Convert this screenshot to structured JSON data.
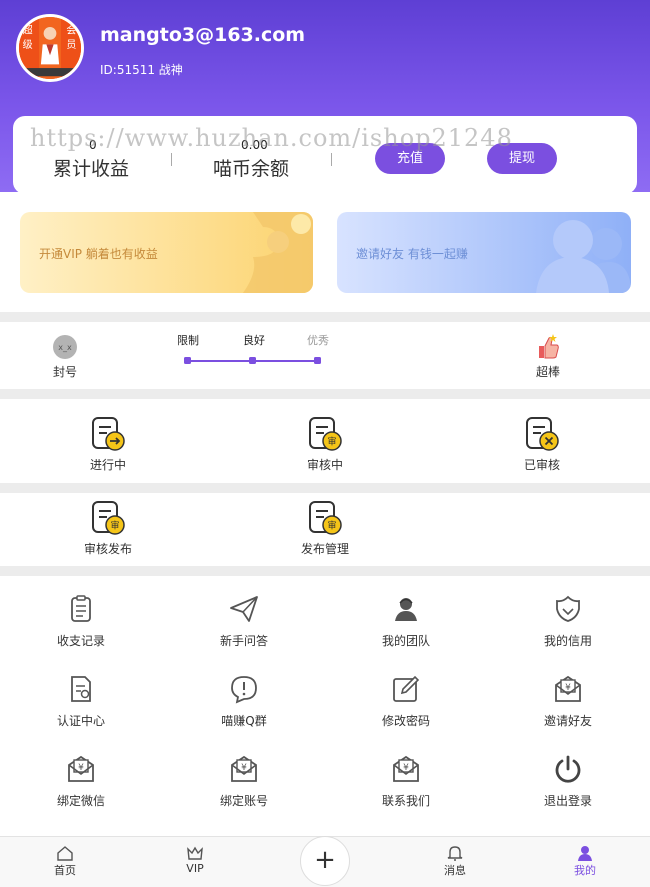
{
  "profile": {
    "email": "mangto3@163.com",
    "uid_text": "ID:51511 战神",
    "avatar_badge": [
      "超",
      "级",
      "会",
      "员"
    ]
  },
  "balance": {
    "total_earnings_value": "0",
    "total_earnings_label": "累计收益",
    "coin_balance_value": "0.00",
    "coin_balance_label": "喵币余额",
    "recharge_label": "充值",
    "withdraw_label": "提现"
  },
  "watermark": "https://www.huzhan.com/ishop21248",
  "banners": {
    "vip_text": "开通VIP 躺着也有收益",
    "invite_text": "邀请好友 有钱一起赚"
  },
  "credit": {
    "banned_label": "封号",
    "excellent_label": "超棒",
    "levels": [
      "限制",
      "良好",
      "优秀"
    ]
  },
  "orders": {
    "row1": [
      {
        "label": "进行中",
        "icon": "task-in-progress-icon"
      },
      {
        "label": "审核中",
        "icon": "task-reviewing-icon"
      },
      {
        "label": "已审核",
        "icon": "task-reviewed-icon"
      }
    ],
    "row2": [
      {
        "label": "审核发布",
        "icon": "review-publish-icon"
      },
      {
        "label": "发布管理",
        "icon": "publish-manage-icon"
      }
    ]
  },
  "menu": [
    {
      "label": "收支记录",
      "icon": "clipboard-icon"
    },
    {
      "label": "新手问答",
      "icon": "paper-plane-icon"
    },
    {
      "label": "我的团队",
      "icon": "team-icon"
    },
    {
      "label": "我的信用",
      "icon": "shield-icon"
    },
    {
      "label": "认证中心",
      "icon": "certificate-icon"
    },
    {
      "label": "喵赚Q群",
      "icon": "chat-alert-icon"
    },
    {
      "label": "修改密码",
      "icon": "edit-icon"
    },
    {
      "label": "邀请好友",
      "icon": "yuan-envelope-icon"
    },
    {
      "label": "绑定微信",
      "icon": "yuan-envelope-icon"
    },
    {
      "label": "绑定账号",
      "icon": "yuan-envelope-icon"
    },
    {
      "label": "联系我们",
      "icon": "yuan-envelope-icon"
    },
    {
      "label": "退出登录",
      "icon": "power-icon"
    }
  ],
  "tabbar": {
    "home": "首页",
    "vip": "VIP",
    "plus": "+",
    "messages": "消息",
    "mine": "我的"
  },
  "colors": {
    "brand_purple": "#7b4fe0",
    "header_gradient_top": "#5e3fd4",
    "header_gradient_bottom": "#8e6cf3",
    "vip_banner": "#fde39a",
    "invite_banner": "#a9c2fb",
    "coin_yellow": "#f5c518"
  }
}
